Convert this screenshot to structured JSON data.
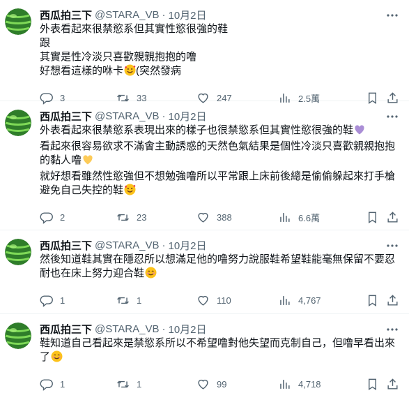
{
  "colors": {
    "text": "#0f1419",
    "secondary": "#536471",
    "divider": "#eff3f4"
  },
  "icons": [
    "avatar-watermelon",
    "more-icon",
    "reply-icon",
    "retweet-icon",
    "like-icon",
    "views-icon",
    "bookmark-icon",
    "share-icon"
  ],
  "tweets": [
    {
      "name": "西瓜拍三下",
      "handle": "@STARA_VB",
      "dot": "·",
      "date": "10月2日",
      "lines": [
        {
          "text": "外表看起來很禁慾系但其實性慾很強的鞋",
          "emoji": ""
        },
        {
          "text": "跟",
          "emoji": ""
        },
        {
          "text": "其實是性冷淡只喜歡親親抱抱的噜",
          "emoji": ""
        },
        {
          "text": "好想看這樣的咻卡",
          "emoji": "smiling-face-with-hearts",
          "after": "(突然發病"
        }
      ],
      "replies": "3",
      "retweets": "33",
      "likes": "247",
      "views": "2.5萬"
    },
    {
      "name": "西瓜拍三下",
      "handle": "@STARA_VB",
      "dot": "·",
      "date": "10月2日",
      "lines": [
        {
          "text": "外表看起來很禁慾系表現出來的樣子也很禁慾系但其實性慾很強的鞋",
          "emoji": "purple-heart"
        },
        {
          "text": "看起來很容易欲求不滿會主動誘惑的天然色氣結果是個性冷淡只喜歡親親抱抱的黏人噜",
          "emoji": "yellow-heart",
          "wrap": true
        },
        {
          "text": "就好想看雖然性慾強但不想勉強噜所以平常跟上床前後總是偷偷躲起來打手槍避免自己失控的鞋",
          "emoji": "smiling-face-with-hearts",
          "wrap": true
        }
      ],
      "replies": "2",
      "retweets": "23",
      "likes": "388",
      "views": "6.6萬"
    },
    {
      "name": "西瓜拍三下",
      "handle": "@STARA_VB",
      "dot": "·",
      "date": "10月2日",
      "lines": [
        {
          "text": "然後知道鞋其實在隱忍所以想滿足他的噜努力說服鞋希望鞋能毫無保留不要忍耐也在床上努力迎合鞋",
          "emoji": "smiling-face",
          "wrap": true
        }
      ],
      "replies": "1",
      "retweets": "1",
      "likes": "110",
      "views": "4,767"
    },
    {
      "name": "西瓜拍三下",
      "handle": "@STARA_VB",
      "dot": "·",
      "date": "10月2日",
      "lines": [
        {
          "text": "鞋知道自己看起來是禁慾系所以不希望噜對他失望而克制自己，但噜早看出來了",
          "emoji": "smiling-face",
          "wrap": true
        }
      ],
      "replies": "1",
      "retweets": "1",
      "likes": "99",
      "views": "4,718"
    }
  ]
}
